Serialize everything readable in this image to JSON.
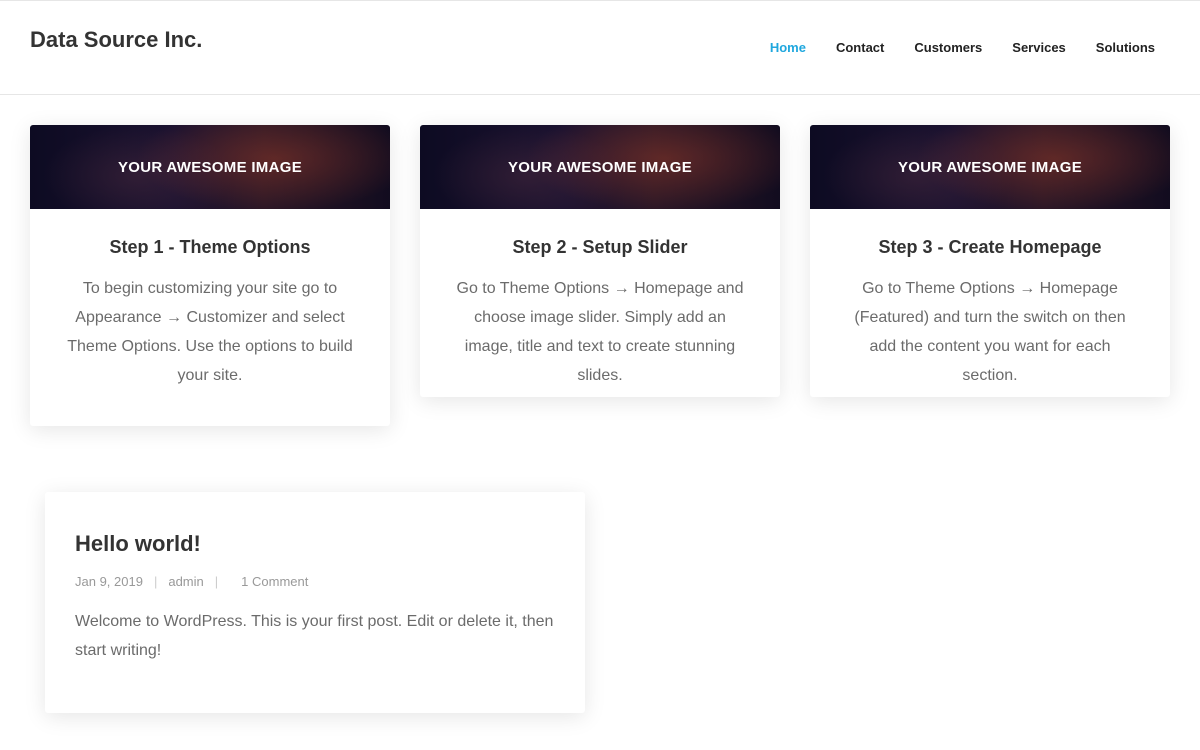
{
  "site": {
    "title": "Data Source Inc."
  },
  "nav": [
    {
      "label": "Home",
      "active": true
    },
    {
      "label": "Contact"
    },
    {
      "label": "Customers"
    },
    {
      "label": "Services"
    },
    {
      "label": "Solutions"
    }
  ],
  "features": [
    {
      "banner_text": "YOUR AWESOME IMAGE",
      "title": "Step 1 - Theme Options",
      "text": "To begin customizing your site go to Appearance → Customizer and select Theme Options. Use the options to build your site."
    },
    {
      "banner_text": "YOUR AWESOME IMAGE",
      "title": "Step 2 - Setup Slider",
      "text": "Go to Theme Options → Homepage and choose image slider. Simply add an image, title and text to create stunning slides."
    },
    {
      "banner_text": "YOUR AWESOME IMAGE",
      "title": "Step 3 - Create Homepage",
      "text": "Go to Theme Options → Homepage (Featured) and turn the switch on then add the content you want for each section."
    }
  ],
  "post": {
    "title": "Hello world!",
    "date": "Jan 9, 2019",
    "author": "admin",
    "comments": "1 Comment",
    "excerpt": "Welcome to WordPress. This is your first post. Edit or delete it, then start writing!"
  },
  "colors": {
    "accent": "#1fa7de",
    "text": "#333333",
    "muted": "#6b6b6b"
  }
}
